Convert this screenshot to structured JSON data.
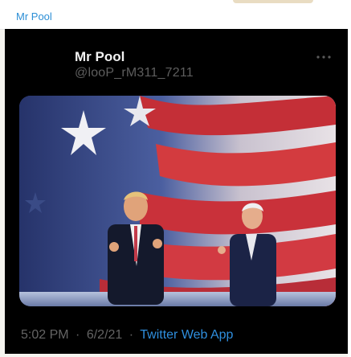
{
  "window": {
    "title": "Mr Pool"
  },
  "tweet": {
    "display_name": "Mr Pool",
    "handle": "@looP_rM311_7211",
    "more_icon": "ellipsis-horizontal-icon",
    "time": "5:02 PM",
    "date": "6/2/21",
    "separator": "·",
    "source": "Twitter Web App"
  },
  "colors": {
    "accent": "#2f8fde",
    "card_bg": "#000000",
    "secondary_text": "#646464"
  }
}
